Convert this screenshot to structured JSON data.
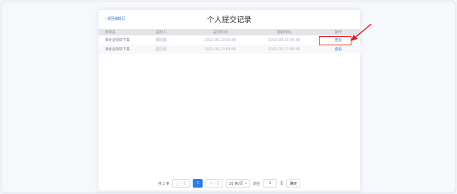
{
  "page": {
    "back_label": "返回编辑页",
    "title": "个人提交记录"
  },
  "table": {
    "headers": [
      "表单名",
      "提交人",
      "提交时间",
      "更新时间",
      "操作"
    ],
    "rows": [
      {
        "form": "准考证领取下载",
        "submit_time": "2022-03-23 09:30",
        "update_time": "2022-03-23 09:30",
        "action": "查看"
      },
      {
        "form": "准考证领取下载",
        "submit_time": "2022-03-23 09:56",
        "update_time": "2022-03-23 09:56",
        "action": "查看"
      }
    ]
  },
  "pagination": {
    "total": "共 2 条",
    "prev": "上一页",
    "current_page": "1",
    "next": "下一页",
    "page_size": "20 条/页",
    "goto_label": "前往",
    "goto_value": "1",
    "page_unit": "页",
    "confirm": "确定"
  },
  "colors": {
    "accent": "#2d7be5",
    "annotation": "#e02020"
  }
}
